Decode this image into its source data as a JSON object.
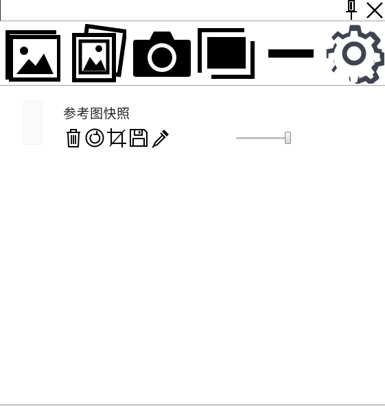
{
  "titlebar": {
    "pin_icon": "pin-icon",
    "close_icon": "close-icon"
  },
  "toolbar": {
    "tools": [
      {
        "name": "image-icon"
      },
      {
        "name": "images-stack-icon"
      },
      {
        "name": "camera-icon"
      },
      {
        "name": "window-restore-icon"
      },
      {
        "name": "minimize-icon"
      },
      {
        "name": "gear-icon"
      }
    ]
  },
  "content": {
    "items": [
      {
        "title": "参考图快照",
        "tools": [
          "trash-icon",
          "rotate-icon",
          "crop-icon",
          "save-icon",
          "eyedropper-icon"
        ],
        "opacity": 1.0
      }
    ]
  },
  "colors": {
    "icon_dark": "#000000",
    "gear": "#3f4450",
    "separator": "#a0a0a0"
  }
}
